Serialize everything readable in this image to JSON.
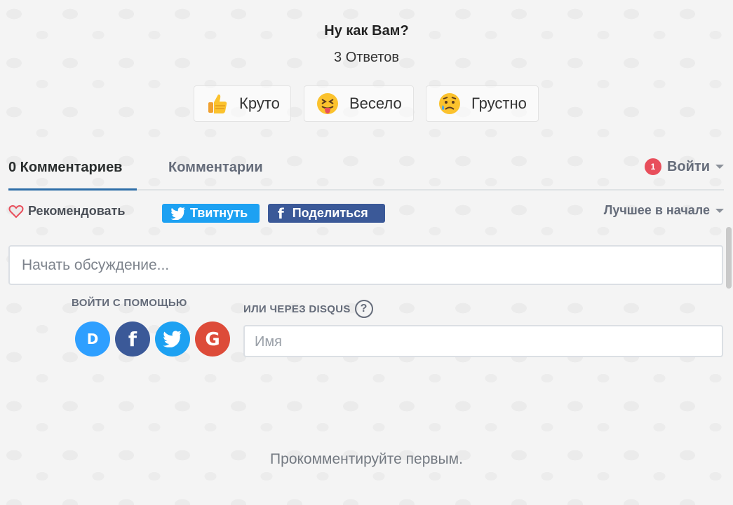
{
  "reactions": {
    "title": "Ну как Вам?",
    "count": "3 Ответов",
    "items": [
      {
        "label": "Круто",
        "icon": "thumbs-up-icon"
      },
      {
        "label": "Весело",
        "icon": "tongue-out-face-icon"
      },
      {
        "label": "Грустно",
        "icon": "sad-face-icon"
      }
    ]
  },
  "tabs": {
    "active": "0 Комментариев",
    "community": "Комментарии",
    "login_label": "Войти",
    "login_badge": "1"
  },
  "actions": {
    "recommend": "Рекомендовать",
    "tweet": "Твитнуть",
    "share": "Поделиться",
    "share_icon": "f",
    "sort": "Лучшее в начале"
  },
  "composer": {
    "placeholder": "Начать обсуждение...",
    "login_with": "ВОЙТИ С ПОМОЩЬЮ",
    "or_disqus": "ИЛИ ЧЕРЕЗ DISQUS",
    "help": "?",
    "name_placeholder": "Имя",
    "social": [
      "disqus-icon",
      "facebook-icon",
      "twitter-icon",
      "google-icon"
    ]
  },
  "empty_state": "Прокомментируйте первым.",
  "colors": {
    "accent": "#2e6ea8",
    "twitter": "#1da1f2",
    "facebook": "#3b5998",
    "google": "#dd4b39",
    "disqus": "#2e9fff",
    "badge": "#e84e5b"
  }
}
